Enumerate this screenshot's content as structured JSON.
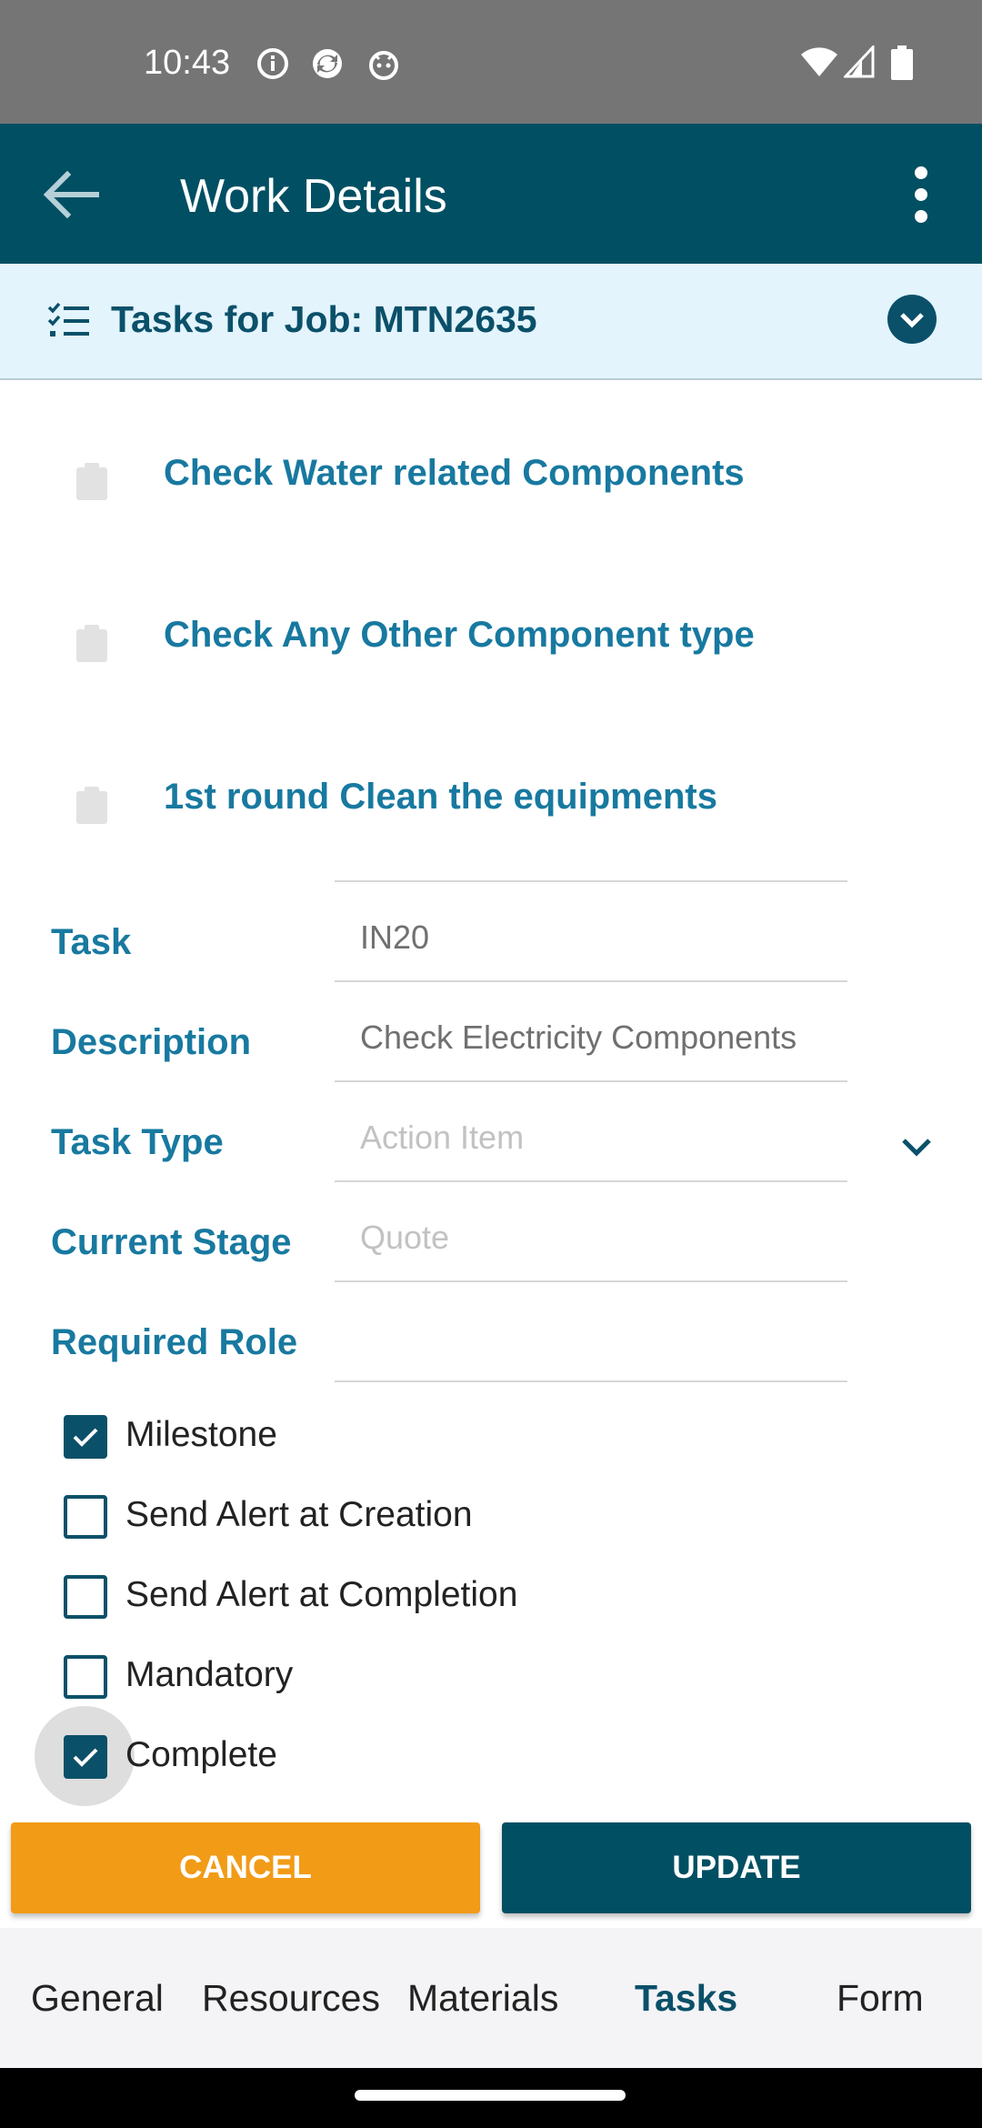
{
  "status_bar": {
    "time": "10:43",
    "icons": [
      "info-icon",
      "sync-icon",
      "android-icon",
      "wifi-icon",
      "signal-icon",
      "battery-icon"
    ]
  },
  "app_bar": {
    "title": "Work Details",
    "back_icon": "arrow-back-icon",
    "menu_icon": "more-vert-icon"
  },
  "job_header": {
    "label": "Tasks for Job: MTN2635",
    "icon": "checklist-icon",
    "expand_icon": "chevron-down-circle-icon"
  },
  "tasks": [
    {
      "name": "Check Water related Components"
    },
    {
      "name": "Check Any Other Component type"
    },
    {
      "name": "1st round Clean the equipments"
    }
  ],
  "form": {
    "task": {
      "label": "Task",
      "value": "IN20"
    },
    "description": {
      "label": "Description",
      "value": "Check Electricity Components"
    },
    "task_type": {
      "label": "Task Type",
      "value": "Action Item"
    },
    "current_stage": {
      "label": "Current Stage",
      "value": "Quote"
    },
    "required_role": {
      "label": "Required Role",
      "value": ""
    }
  },
  "checkboxes": [
    {
      "label": "Milestone",
      "checked": true
    },
    {
      "label": "Send Alert at Creation",
      "checked": false
    },
    {
      "label": "Send Alert at Completion",
      "checked": false
    },
    {
      "label": "Mandatory",
      "checked": false
    },
    {
      "label": "Complete",
      "checked": true
    }
  ],
  "buttons": {
    "cancel": "CANCEL",
    "update": "UPDATE"
  },
  "bottom_tabs": [
    {
      "label": "General",
      "active": false
    },
    {
      "label": "Resources",
      "active": false
    },
    {
      "label": "Materials",
      "active": false
    },
    {
      "label": "Tasks",
      "active": true
    },
    {
      "label": "Form",
      "active": false
    }
  ],
  "colors": {
    "primary": "#004f63",
    "accent": "#f29b17",
    "link": "#1879a0",
    "header_bg": "#e3f4fd"
  }
}
